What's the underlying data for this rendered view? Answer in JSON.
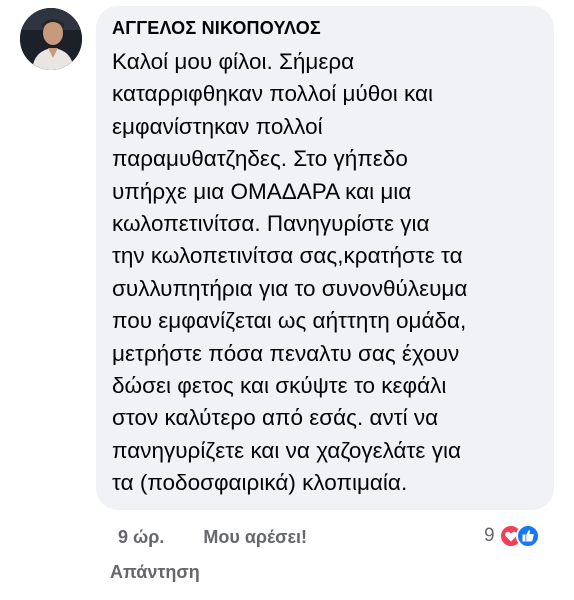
{
  "comment": {
    "author": "ΑΓΓΕΛΟΣ ΝΙΚΟΠΟΥΛΟΣ",
    "lines": [
      "Καλοί μου φίλοι. Σήμερα",
      "καταρριφθηκαν πολλοί μύθοι και",
      "εμφανίστηκαν πολλοί",
      "παραμυθατζηδες. Στο γήπεδο",
      "υπήρχε μια ΟΜΑΔΑΡΑ και μια",
      "κωλοπετινίτσα. Πανηγυρίστε για",
      "την κωλοπετινίτσα σας,κρατήστε τα",
      "συλλυπητήρια για το συνονθύλευμα",
      "που εμφανίζεται ως αήττητη ομάδα,",
      "μετρήστε πόσα πεναλτυ σας έχουν",
      "δώσει φετος και σκύψτε το κεφάλι",
      "στον καλύτερο από εσάς. αντί να",
      "πανηγυρίζετε και να χαζογελάτε για",
      "τα (ποδοσφαιρικά) κλοπιμαία."
    ]
  },
  "actions": {
    "time": "9 ώρ.",
    "like_label": "Μου αρέσει!",
    "reply_label": "Απάντηση"
  },
  "reactions": {
    "count": "9",
    "icons": [
      "love-icon",
      "like-icon"
    ],
    "colors": {
      "love": "#f33e58",
      "like": "#1877f2",
      "muted_text": "#65676b",
      "bubble": "#f0f2f5"
    }
  }
}
